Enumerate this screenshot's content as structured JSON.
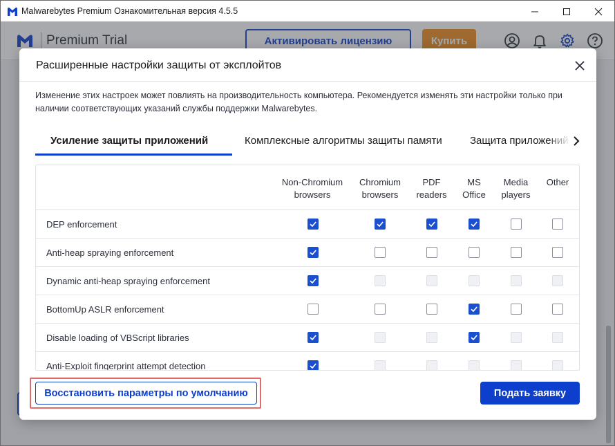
{
  "window": {
    "title": "Malwarebytes Premium Ознакомительная версия  4.5.5"
  },
  "app": {
    "title": "Premium Trial",
    "activate_label": "Активировать лицензию",
    "buy_label": "Купить"
  },
  "dialog": {
    "title": "Расширенные настройки защиты от эксплойтов",
    "description": "Изменение этих настроек может повлиять на производительность компьютера. Рекомендуется изменять эти настройки только при наличии соответствующих указаний службы поддержки Malwarebytes.",
    "tabs": [
      {
        "label": "Усиление защиты приложений",
        "active": true
      },
      {
        "label": "Комплексные алгоритмы защиты памяти",
        "active": false
      },
      {
        "label": "Защита приложений",
        "active": false
      }
    ],
    "table": {
      "columns": [
        {
          "line1": "Non-Chromium",
          "line2": "browsers"
        },
        {
          "line1": "Chromium",
          "line2": "browsers"
        },
        {
          "line1": "PDF",
          "line2": "readers"
        },
        {
          "line1": "MS",
          "line2": "Office"
        },
        {
          "line1": "Media",
          "line2": "players"
        },
        {
          "line1": "Other",
          "line2": ""
        }
      ],
      "rows": [
        {
          "label": "DEP enforcement",
          "states": [
            "on",
            "on",
            "on",
            "on",
            "off",
            "off"
          ]
        },
        {
          "label": "Anti-heap spraying enforcement",
          "states": [
            "on",
            "off",
            "off",
            "off",
            "off",
            "off"
          ]
        },
        {
          "label": "Dynamic anti-heap spraying enforcement",
          "states": [
            "on",
            "disabled",
            "disabled",
            "disabled",
            "disabled",
            "disabled"
          ]
        },
        {
          "label": "BottomUp ASLR enforcement",
          "states": [
            "off",
            "off",
            "off",
            "on",
            "off",
            "off"
          ]
        },
        {
          "label": "Disable loading of VBScript libraries",
          "states": [
            "on",
            "disabled",
            "disabled",
            "on",
            "disabled",
            "disabled"
          ]
        },
        {
          "label": "Anti-Exploit fingerprint attempt detection",
          "states": [
            "on",
            "disabled",
            "disabled",
            "disabled",
            "disabled",
            "disabled"
          ]
        }
      ]
    },
    "restore_label": "Восстановить параметры по умолчанию",
    "submit_label": "Подать заявку"
  },
  "colors": {
    "accent": "#0d3ecc",
    "buy": "#f08a1c",
    "highlight": "#e46b6b"
  },
  "icons": {
    "app": "malwarebytes-logo-icon",
    "header": [
      "user-icon",
      "bell-icon",
      "gear-icon",
      "help-icon"
    ],
    "tabs_scroll": "chevron-right-icon"
  }
}
